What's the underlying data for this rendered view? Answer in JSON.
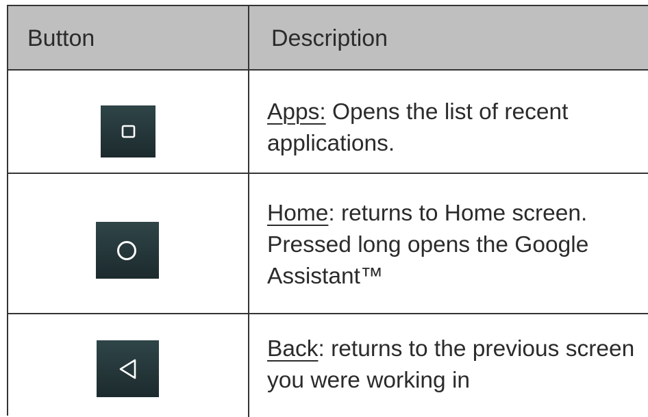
{
  "table": {
    "headers": {
      "button": "Button",
      "description": "Description"
    },
    "rows": [
      {
        "icon": "square-icon",
        "term": "Apps:",
        "text": " Opens the list of recent applications."
      },
      {
        "icon": "circle-icon",
        "term": "Home",
        "text": ": returns to Home screen. Pressed long opens the Google Assistant™"
      },
      {
        "icon": "triangle-left-icon",
        "term": "Back",
        "text": ": returns to the previous screen you were working in"
      }
    ]
  },
  "colors": {
    "header_background": "#bfbfbf",
    "button_background": "#22363a",
    "border": "#333333"
  }
}
